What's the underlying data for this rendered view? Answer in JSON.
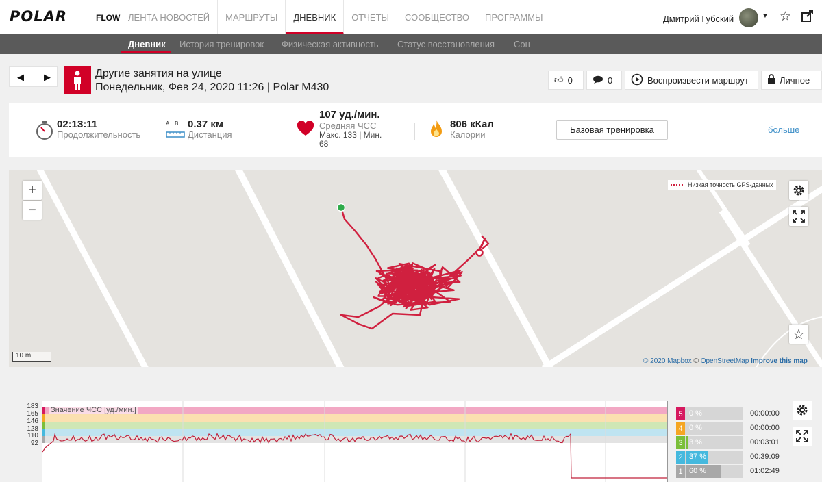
{
  "nav": {
    "logo": "POLAR",
    "product": "FLOW",
    "links": [
      "ЛЕНТА НОВОСТЕЙ",
      "МАРШРУТЫ",
      "ДНЕВНИК",
      "ОТЧЕТЫ",
      "СООБЩЕСТВО",
      "ПРОГРАММЫ"
    ],
    "active": "ДНЕВНИК",
    "user_name": "Дмитрий Губский"
  },
  "subnav": {
    "items": [
      "Дневник",
      "История тренировок",
      "Физическая активность",
      "Статус восстановления",
      "Сон"
    ],
    "active": "Дневник"
  },
  "workout": {
    "title": "Другие занятия на улице",
    "subtitle": "Понедельник, Фев 24, 2020 11:26 | Polar M430",
    "likes": "0",
    "comments": "0",
    "replay_label": "Воспроизвести маршрут",
    "privacy_label": "Личное"
  },
  "summary": {
    "duration_value": "02:13:11",
    "duration_label": "Продолжительность",
    "distance_ab": "A B",
    "distance_value": "0.37 км",
    "distance_label": "Дистанция",
    "hr_value": "107 уд./мин.",
    "hr_label": "Средняя ЧСС",
    "hr_minmax_1": "Макс. 133  |  Мин.",
    "hr_minmax_2": "68",
    "calories_value": "806 кКал",
    "calories_label": "Калории",
    "base_button": "Базовая тренировка",
    "more_link": "больше"
  },
  "map": {
    "zoom_in": "+",
    "zoom_out": "−",
    "gps_legend": "Низкая точность GPS-данных",
    "scale": "10 m",
    "attribution_1": "© 2020 Mapbox",
    "attribution_2": "© ",
    "attribution_osm": "OpenStreetMap",
    "attribution_improve": "Improve this map",
    "route_color": "#d0203f"
  },
  "hr_chart": {
    "series_label": "Значение ЧСС [уд./мин.]",
    "y_ticks": [
      "183",
      "165",
      "146",
      "128",
      "110",
      "92"
    ],
    "line_color": "#c0203a",
    "zones": [
      {
        "num": "5",
        "pct": "0 %",
        "time": "00:00:00",
        "color": "#d6195f",
        "fraction": 0.0
      },
      {
        "num": "4",
        "pct": "0 %",
        "time": "00:00:00",
        "color": "#f5a623",
        "fraction": 0.0
      },
      {
        "num": "3",
        "pct": "3 %",
        "time": "00:03:01",
        "color": "#7bbf3a",
        "fraction": 0.03
      },
      {
        "num": "2",
        "pct": "37 %",
        "time": "00:39:09",
        "color": "#45b9de",
        "fraction": 0.37
      },
      {
        "num": "1",
        "pct": "60 %",
        "time": "01:02:49",
        "color": "#a8a8a8",
        "fraction": 0.6
      }
    ]
  }
}
